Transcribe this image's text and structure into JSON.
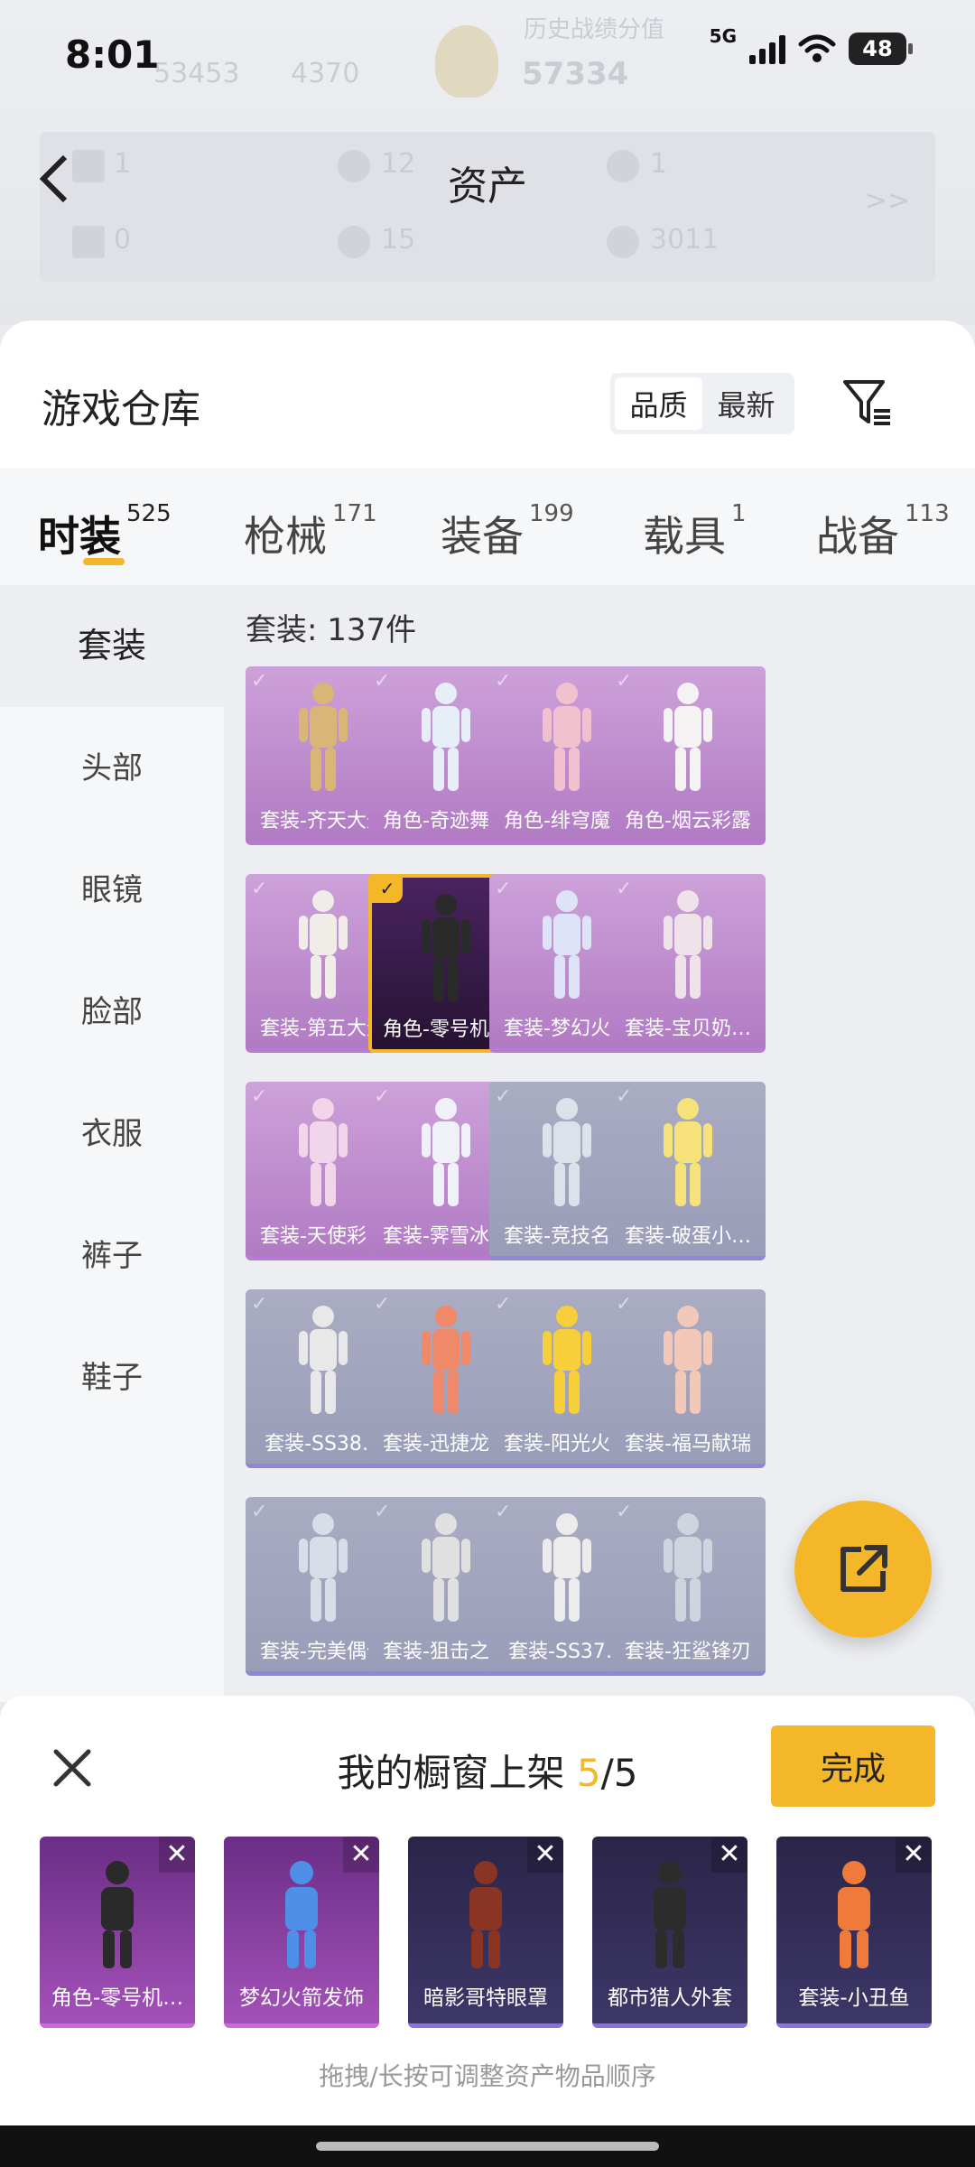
{
  "status": {
    "time": "8:01",
    "network": "5G",
    "battery": "48"
  },
  "header": {
    "title": "资产",
    "background_stats": [
      {
        "label": "历史战绩分值",
        "value": "57334"
      },
      {
        "label": "",
        "value": "53453"
      },
      {
        "label": "",
        "value": "4370"
      }
    ],
    "asset_counts": [
      {
        "value": "1"
      },
      {
        "value": "12"
      },
      {
        "value": "1"
      },
      {
        "value": "0"
      },
      {
        "value": "15"
      },
      {
        "value": "3011"
      }
    ],
    "more_icon": ">>"
  },
  "warehouse": {
    "title": "游戏仓库",
    "sort_options": [
      "品质",
      "最新"
    ],
    "sort_selected": "品质"
  },
  "tabs": [
    {
      "label": "时装",
      "count": "525"
    },
    {
      "label": "枪械",
      "count": "171"
    },
    {
      "label": "装备",
      "count": "199"
    },
    {
      "label": "载具",
      "count": "1"
    },
    {
      "label": "战备",
      "count": "113"
    }
  ],
  "categories": [
    "套装",
    "头部",
    "眼镜",
    "脸部",
    "衣服",
    "裤子",
    "鞋子"
  ],
  "grid": {
    "count_label": "套装: 137件",
    "items": [
      {
        "label": "套装-齐天大圣",
        "quality": "purple"
      },
      {
        "label": "角色-奇迹舞…",
        "quality": "purple"
      },
      {
        "label": "角色-绯穹魔姬",
        "quality": "purple"
      },
      {
        "label": "角色-烟云彩露",
        "quality": "purple"
      },
      {
        "label": "套装-第五大道",
        "quality": "purple"
      },
      {
        "label": "角色-零号机…",
        "quality": "selected"
      },
      {
        "label": "套装-梦幻火箭",
        "quality": "purple"
      },
      {
        "label": "套装-宝贝奶…",
        "quality": "purple"
      },
      {
        "label": "套装-天使彩…",
        "quality": "purple"
      },
      {
        "label": "套装-霁雪冰心",
        "quality": "purple"
      },
      {
        "label": "套装-竞技名士",
        "quality": "blue"
      },
      {
        "label": "套装-破蛋小…",
        "quality": "blue"
      },
      {
        "label": "套装-SS38…",
        "quality": "blue"
      },
      {
        "label": "套装-迅捷龙虾",
        "quality": "blue"
      },
      {
        "label": "套装-阳光火鸡",
        "quality": "blue"
      },
      {
        "label": "套装-福马献瑞",
        "quality": "blue"
      },
      {
        "label": "套装-完美偶像",
        "quality": "blue"
      },
      {
        "label": "套装-狙击之神",
        "quality": "blue"
      },
      {
        "label": "套装-SS37…",
        "quality": "blue"
      },
      {
        "label": "套装-狂鲨锋刃",
        "quality": "blue"
      }
    ]
  },
  "shelf": {
    "title_prefix": "我的橱窗上架 ",
    "current": "5",
    "total": "/5",
    "done_label": "完成",
    "items": [
      {
        "label": "角色-零号机…",
        "quality": "purple"
      },
      {
        "label": "梦幻火箭发饰",
        "quality": "purple"
      },
      {
        "label": "暗影哥特眼罩",
        "quality": "navy"
      },
      {
        "label": "都市猎人外套",
        "quality": "navy"
      },
      {
        "label": "套装-小丑鱼",
        "quality": "navy"
      }
    ],
    "hint": "拖拽/长按可调整资产物品顺序"
  },
  "colors": {
    "accent": "#f5b72a",
    "purple_card": "#b97ad6",
    "blue_card": "#8f87d6"
  }
}
